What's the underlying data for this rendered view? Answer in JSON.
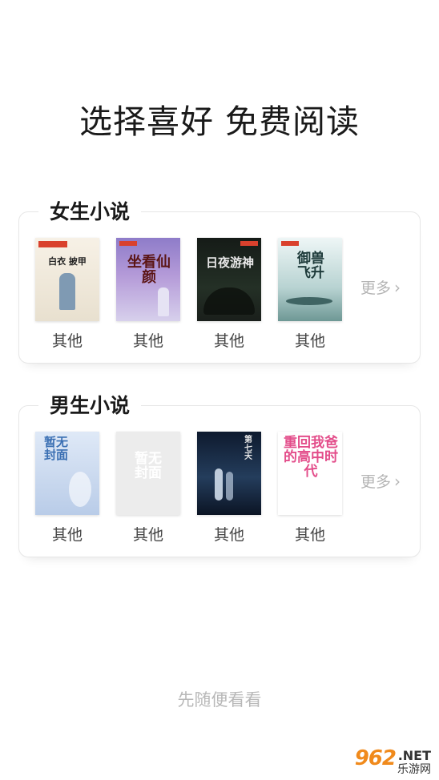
{
  "headline": "选择喜好 免费阅读",
  "female": {
    "title": "女生小说",
    "more": "更多",
    "books": [
      {
        "label": "其他",
        "cover_text": "白衣 披甲",
        "cover_color": "#f3ede1"
      },
      {
        "label": "其他",
        "cover_text": "坐看仙颜",
        "cover_color": "#a08bd0"
      },
      {
        "label": "其他",
        "cover_text": "日夜游神",
        "cover_color": "#1c241e"
      },
      {
        "label": "其他",
        "cover_text": "御兽飞升",
        "cover_color": "#c6dcdb"
      }
    ]
  },
  "male": {
    "title": "男生小说",
    "more": "更多",
    "books": [
      {
        "label": "其他",
        "cover_text": "暂无封面",
        "cover_color": "#cbdaf0"
      },
      {
        "label": "其他",
        "cover_text": "暂无封面",
        "cover_color": "#ececec"
      },
      {
        "label": "其他",
        "cover_text": "第七天",
        "cover_color": "#132540"
      },
      {
        "label": "其他",
        "cover_text": "重回我爸的高中时代",
        "cover_color": "#ffffff"
      }
    ]
  },
  "skip_label": "先随便看看",
  "watermark": {
    "num": "962",
    "net": ".NET",
    "cn": "乐游网"
  }
}
